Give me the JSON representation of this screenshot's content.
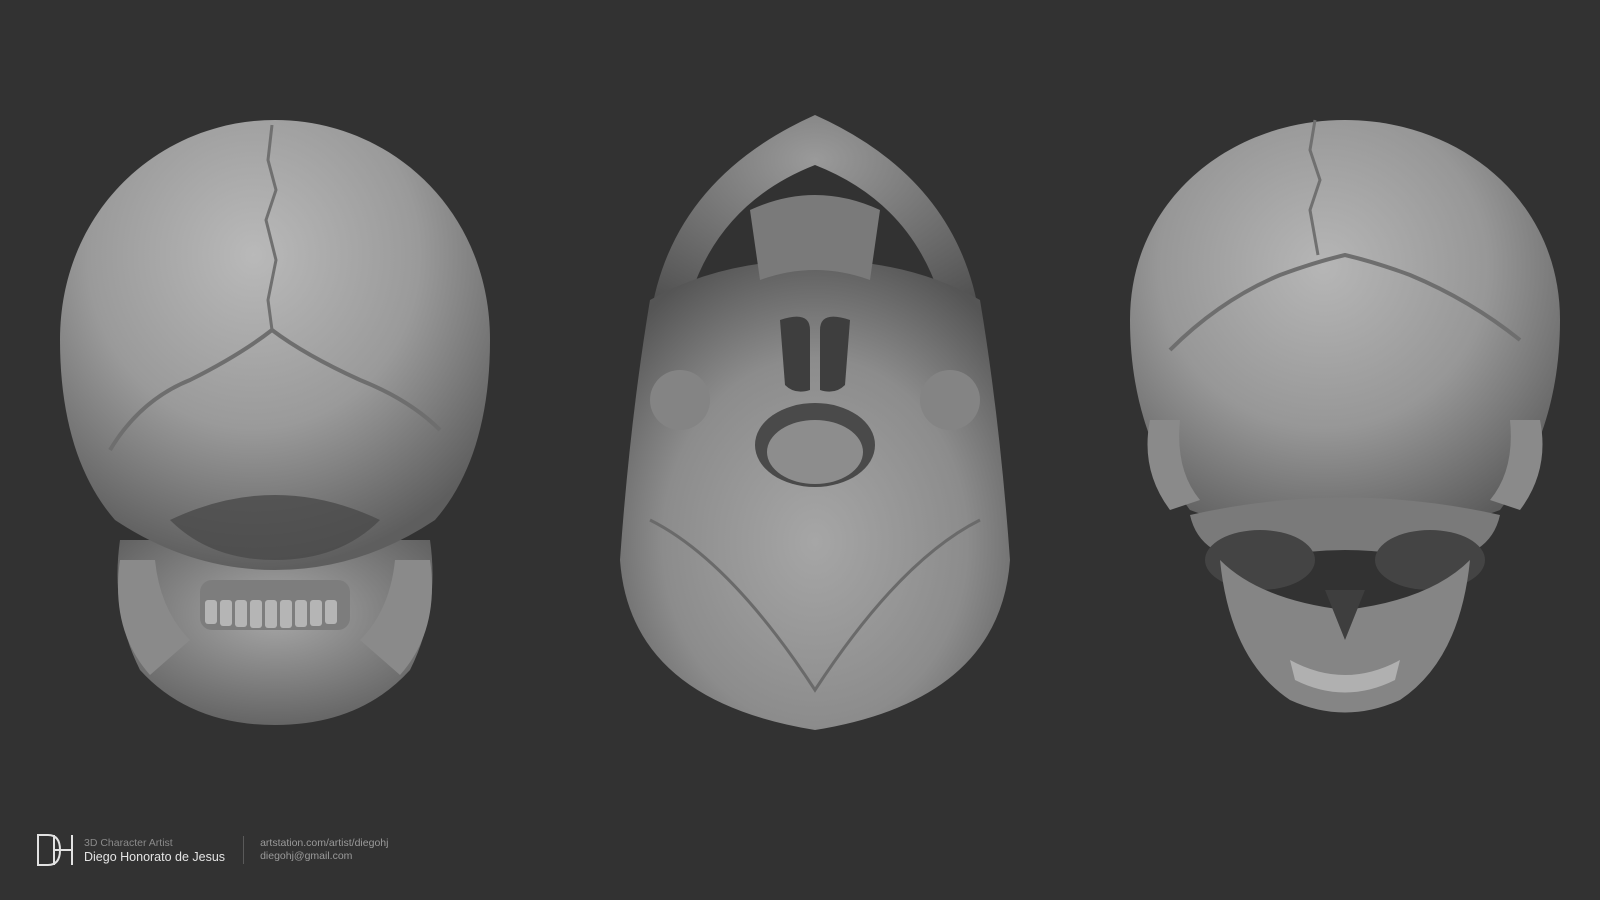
{
  "image": {
    "background_color": "#323232",
    "bone_color": "#9b9b9b",
    "views": [
      {
        "name": "skull-posterior-view"
      },
      {
        "name": "skull-inferior-view"
      },
      {
        "name": "skull-anterior-superior-view"
      }
    ]
  },
  "footer": {
    "logo_icon": "dh-monogram-logo",
    "role": "3D Character Artist",
    "name": "Diego Honorato de Jesus",
    "website": "artstation.com/artist/diegohj",
    "email": "diegohj@gmail.com"
  }
}
